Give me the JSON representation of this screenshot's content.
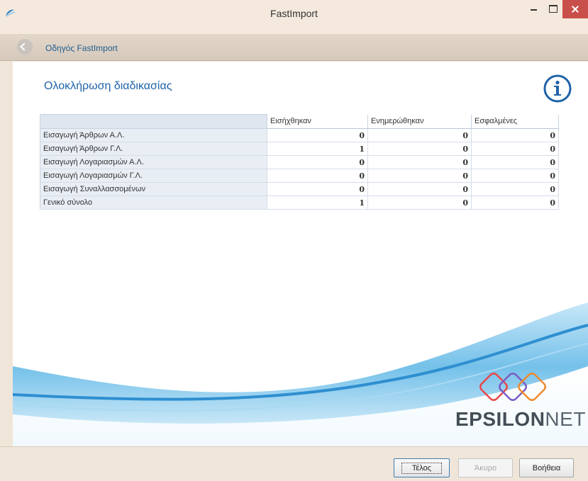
{
  "window": {
    "title": "FastImport"
  },
  "wizard": {
    "name": "Οδηγός FastImport"
  },
  "page": {
    "title": "Ολοκλήρωση διαδικασίας"
  },
  "table": {
    "columns": [
      "",
      "Εισήχθηκαν",
      "Ενημερώθηκαν",
      "Εσφαλμένες"
    ],
    "rows": [
      {
        "label": "Εισαγωγή Άρθρων Α.Λ.",
        "values": [
          "0",
          "0",
          "0"
        ]
      },
      {
        "label": "Εισαγωγή Άρθρων Γ.Λ.",
        "values": [
          "1",
          "0",
          "0"
        ]
      },
      {
        "label": "Εισαγωγή Λογαριασμών Α.Λ.",
        "values": [
          "0",
          "0",
          "0"
        ]
      },
      {
        "label": "Εισαγωγή Λογαριασμών Γ.Λ.",
        "values": [
          "0",
          "0",
          "0"
        ]
      },
      {
        "label": "Εισαγωγή Συναλλασσομένων",
        "values": [
          "0",
          "0",
          "0"
        ]
      },
      {
        "label": "Γενικό σύνολο",
        "values": [
          "1",
          "0",
          "0"
        ]
      }
    ]
  },
  "brand": {
    "bold": "EPSILON",
    "light": "NET"
  },
  "buttons": {
    "finish": "Τέλος",
    "cancel": "Άκυρο",
    "help": "Βοήθεια"
  },
  "icons": {
    "app": "app-swoosh-icon",
    "back": "back-arrow-icon",
    "info": "info-icon",
    "logo": "epsilonnet-logo-icon"
  },
  "colors": {
    "accent": "#1f63a8",
    "close": "#c9504a",
    "window_bg": "#f0e5d9"
  }
}
